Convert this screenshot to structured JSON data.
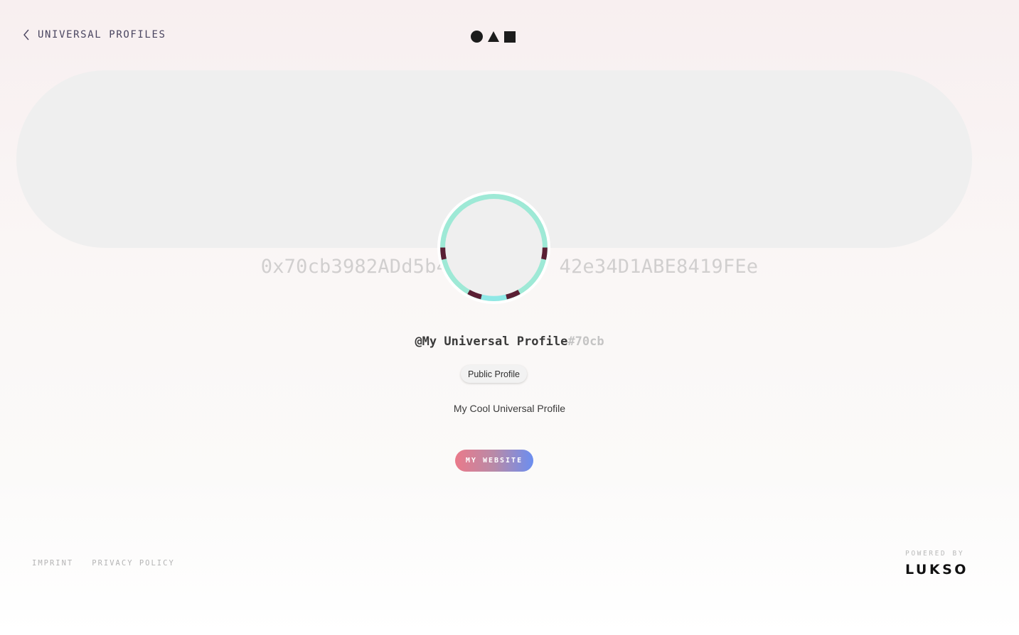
{
  "header": {
    "back_label": "UNIVERSAL PROFILES",
    "back_icon": "chevron-left-icon",
    "logo_icons": [
      "circle-icon",
      "triangle-icon",
      "square-icon"
    ]
  },
  "profile": {
    "address": "0x70cb3982ADd5b4B1D6b7A33F42e34D1ABE8419FEe",
    "address_visible_start": "0x70cb3982ADd5b4B",
    "address_visible_end": "42e34D1ABE8419FEe",
    "handle": "@My Universal Profile",
    "handle_suffix": "#70cb",
    "badge": "Public Profile",
    "description": "My Cool Universal Profile",
    "website_button": "MY WEBSITE"
  },
  "colors": {
    "ring_primary": "#9ee9d6",
    "ring_accent": "#5a1f34",
    "button_gradient_start": "#ea7a8a",
    "button_gradient_end": "#6b8ef0"
  },
  "footer": {
    "imprint": "IMPRINT",
    "privacy": "PRIVACY POLICY",
    "powered_by": "POWERED BY",
    "brand": "LUKSO"
  }
}
